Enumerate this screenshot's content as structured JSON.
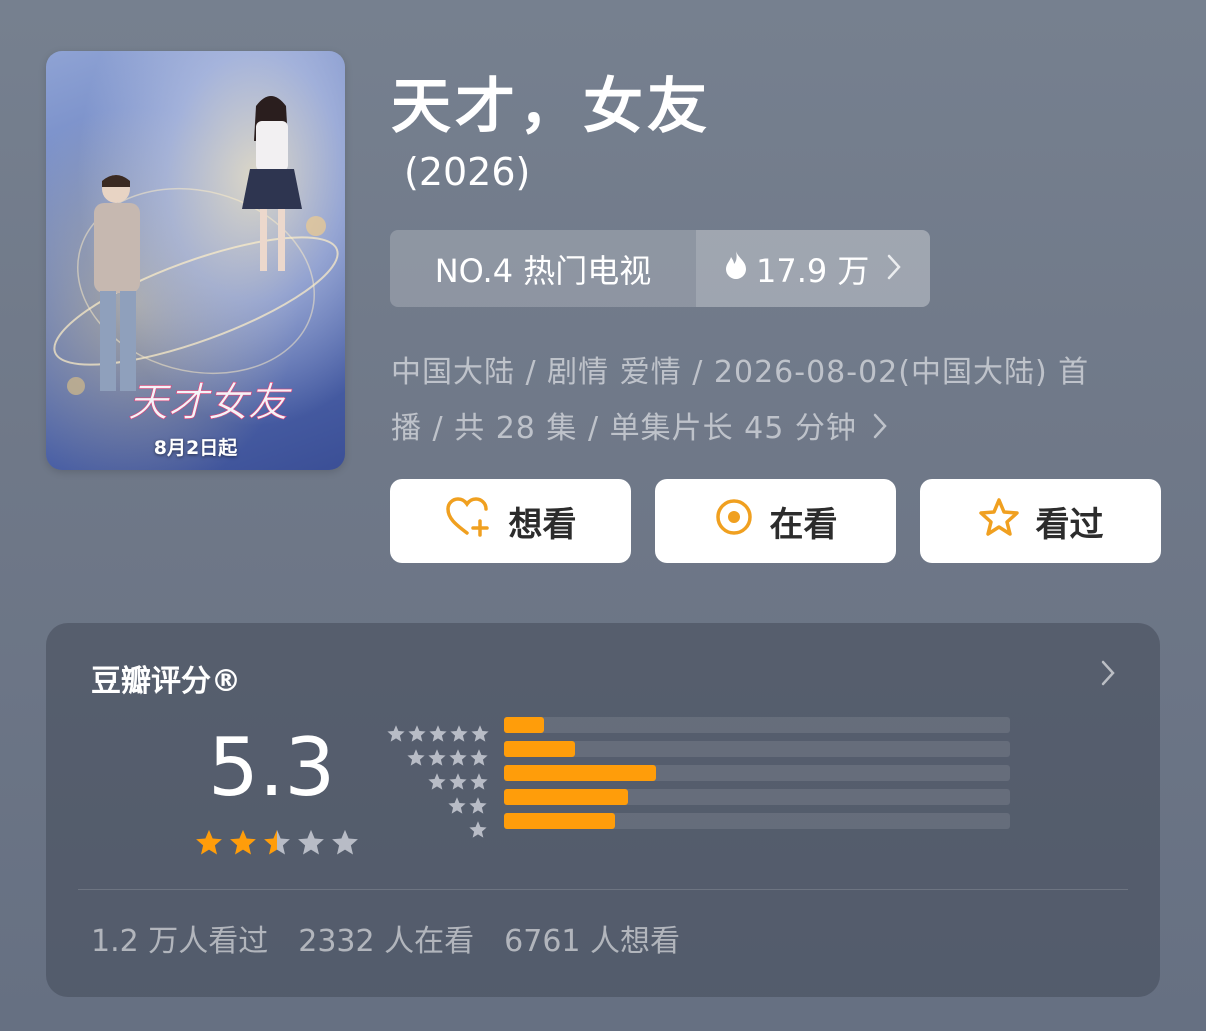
{
  "poster": {
    "date_text": "8月2日起",
    "title_art": "天才女友"
  },
  "title": "天才，女友",
  "year": "(2026)",
  "rank": {
    "label": "NO.4 热门电视",
    "heat": "17.9 万"
  },
  "meta": {
    "line1": "中国大陆 / 剧情 爱情 / 2026-08-02(中国大陆) 首",
    "line2": "播 / 共 28 集 / 单集片长 45 分钟"
  },
  "actions": {
    "want": "想看",
    "watching": "在看",
    "watched": "看过"
  },
  "rating": {
    "title": "豆瓣评分®",
    "score": "5.3",
    "stars": 2.5,
    "distribution": [
      {
        "stars": 5,
        "fraction": 0.08
      },
      {
        "stars": 4,
        "fraction": 0.14
      },
      {
        "stars": 3,
        "fraction": 0.3
      },
      {
        "stars": 2,
        "fraction": 0.245
      },
      {
        "stars": 1,
        "fraction": 0.22
      }
    ],
    "stats": [
      "1.2 万人看过",
      "2332 人在看",
      "6761 人想看"
    ]
  },
  "colors": {
    "accent": "#ff9d0a",
    "star_empty": "#b8bcc6",
    "button_bg": "#ffffff"
  },
  "icons": {
    "want": "heart-plus-icon",
    "watching": "target-circle-icon",
    "watched": "star-outline-icon",
    "heat": "flame-icon",
    "chevron": "chevron-right-icon"
  }
}
